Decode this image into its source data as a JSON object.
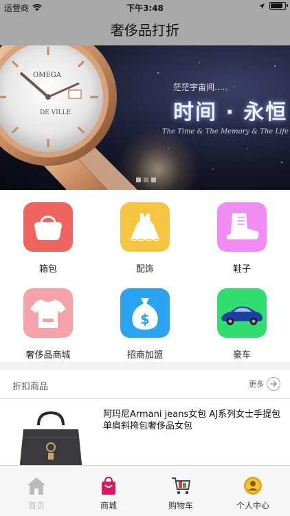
{
  "status": {
    "carrier": "运营商",
    "time": "下午3:48"
  },
  "nav": {
    "title": "奢侈品打折"
  },
  "banner": {
    "slogan_small": "茫茫宇宙间.....",
    "slogan_title": "时间 · 永恒",
    "slogan_sub": "The Time & The Memory & The Life",
    "watch_brand": "OMEGA",
    "watch_model": "DE VILLE",
    "page_indicator": {
      "count": 3,
      "active": 1
    }
  },
  "categories": [
    {
      "label": "箱包",
      "icon": "handbag-icon",
      "color": "#f0645f"
    },
    {
      "label": "配饰",
      "icon": "dress-icon",
      "color": "#f6c542"
    },
    {
      "label": "鞋子",
      "icon": "boot-icon",
      "color": "#f08cf2"
    },
    {
      "label": "奢侈品商城",
      "icon": "tshirt-icon",
      "color": "#f5a3a8"
    },
    {
      "label": "招商加盟",
      "icon": "money-bag-icon",
      "color": "#2aa3f0"
    },
    {
      "label": "豪车",
      "icon": "sports-car-icon",
      "color": "#31dd6e"
    }
  ],
  "section": {
    "title": "折扣商品",
    "more_label": "更多"
  },
  "products": [
    {
      "title": "阿玛尼Armani jeans女包 AJ系列女士手提包单肩斜挎包奢侈品女包"
    }
  ],
  "tabs": [
    {
      "label": "首页",
      "icon": "home-icon"
    },
    {
      "label": "商城",
      "icon": "shopping-bag-icon"
    },
    {
      "label": "购物车",
      "icon": "cart-icon"
    },
    {
      "label": "个人中心",
      "icon": "profile-icon"
    }
  ],
  "colors": {
    "bar_gray": "#a9a9a9",
    "tab_inactive": "#bbbbbb"
  }
}
